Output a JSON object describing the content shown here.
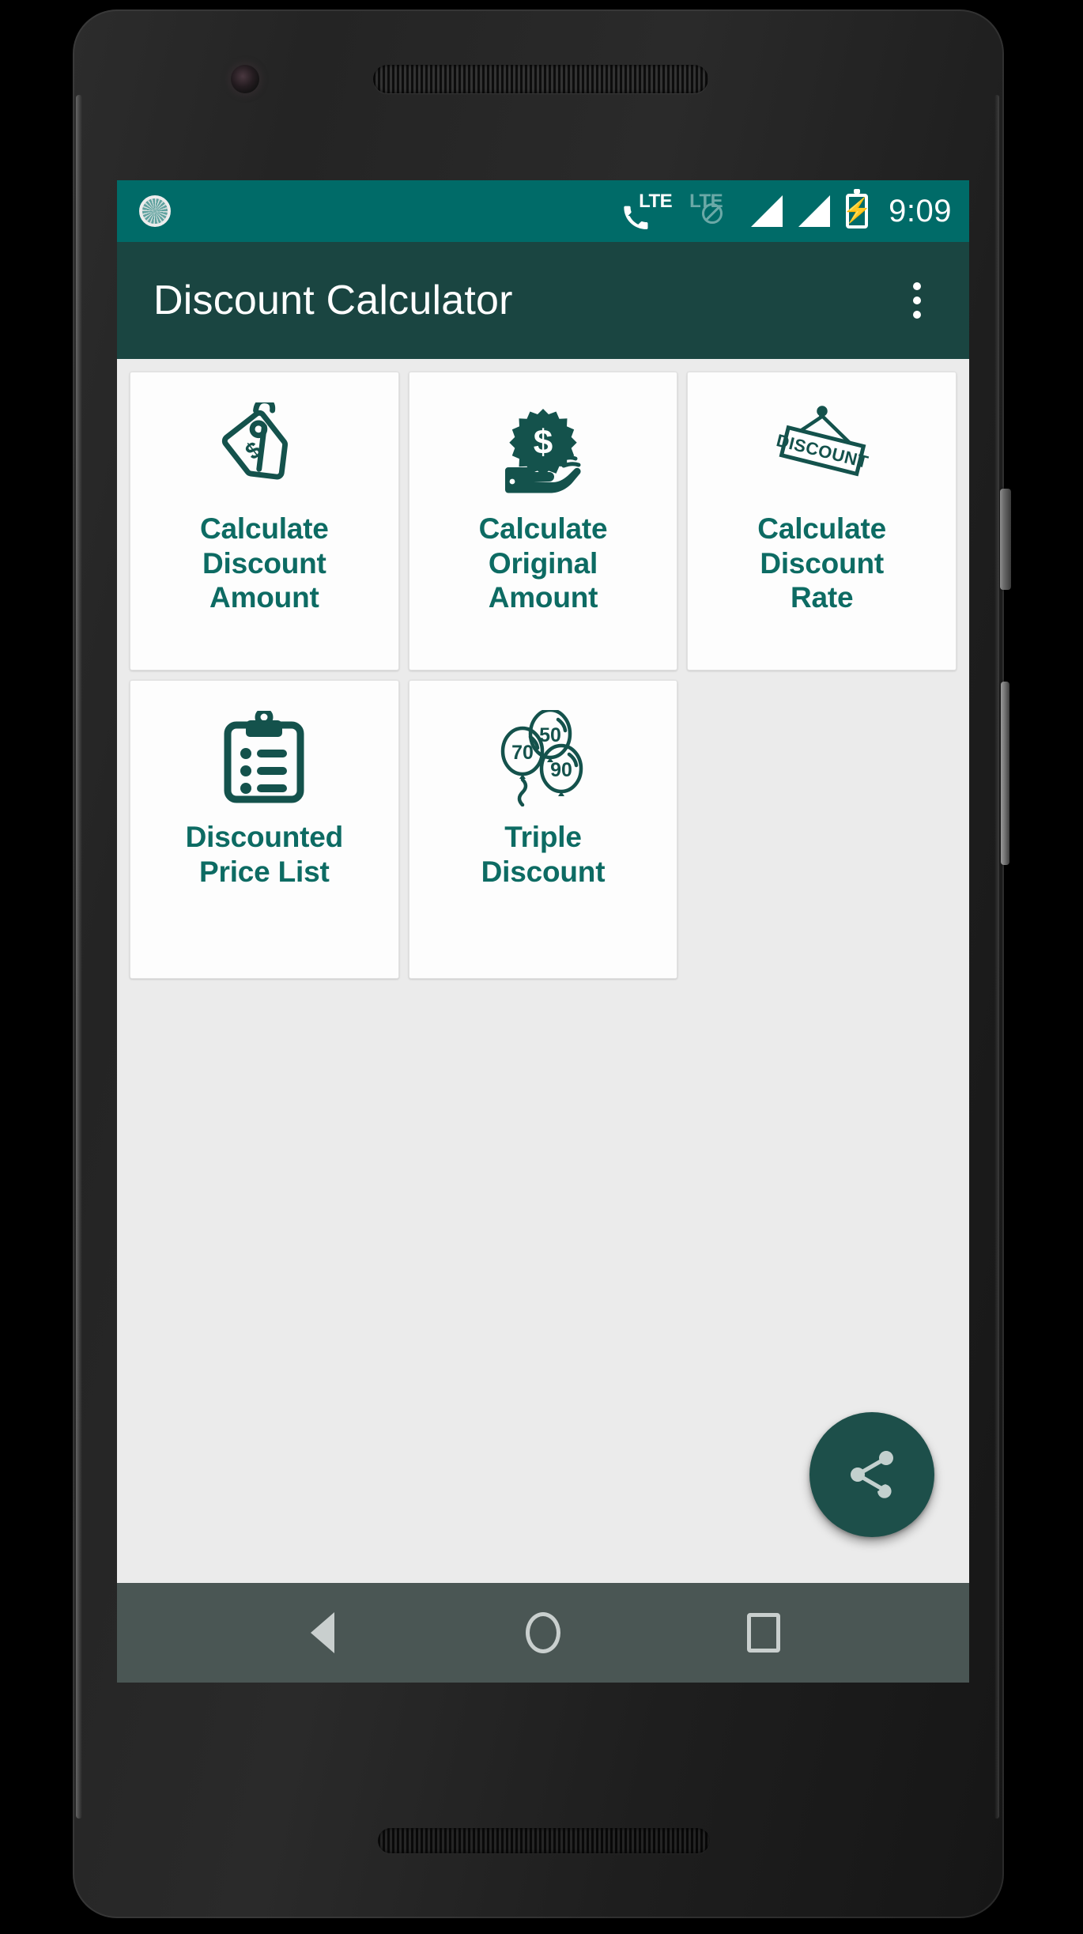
{
  "status_bar": {
    "sync_icon": "sync-icon",
    "call_lte_icon": "phone-lte-icon",
    "call_lte_label": "LTE",
    "lte_disabled_icon": "lte-no-service-icon",
    "lte_disabled_label": "LTE",
    "signal_icon_1": "signal-bars-icon",
    "signal_icon_2": "signal-bars-icon",
    "battery_icon": "battery-charging-icon",
    "clock": "9:09",
    "bg_color": "#006B68"
  },
  "app_bar": {
    "title": "Discount Calculator",
    "overflow_icon": "more-vertical-icon",
    "bg_color": "#1A4541",
    "title_color": "#FFFFFF"
  },
  "content": {
    "bg_color": "#EBEBEB",
    "accent_color": "#0D6B63",
    "cards": [
      {
        "id": "calculate-discount-amount",
        "icon": "price-tag-dollar-icon",
        "label": "Calculate\nDiscount\nAmount"
      },
      {
        "id": "calculate-original-amount",
        "icon": "hand-holding-dollar-badge-icon",
        "label": "Calculate\nOriginal\nAmount"
      },
      {
        "id": "calculate-discount-rate",
        "icon": "hanging-discount-sign-icon",
        "label": "Calculate\nDiscount\nRate"
      },
      {
        "id": "discounted-price-list",
        "icon": "clipboard-list-icon",
        "label": "Discounted\nPrice List"
      },
      {
        "id": "triple-discount",
        "icon": "balloons-icon",
        "label": "Triple\nDiscount",
        "balloon_values": [
          "50",
          "70",
          "90"
        ]
      }
    ]
  },
  "fab": {
    "icon": "share-icon",
    "bg_color": "#1D4F4A"
  },
  "nav_bar": {
    "bg_color": "#4A5654",
    "back_icon": "back-triangle-icon",
    "home_icon": "home-circle-icon",
    "recents_icon": "recents-square-icon"
  },
  "device": {
    "front_camera_icon": "front-camera-icon",
    "earpiece_icon": "earpiece-speaker-icon",
    "bottom_speaker_icon": "bottom-speaker-icon",
    "power_button_icon": "power-button",
    "volume_button_icon": "volume-rocker-button"
  }
}
